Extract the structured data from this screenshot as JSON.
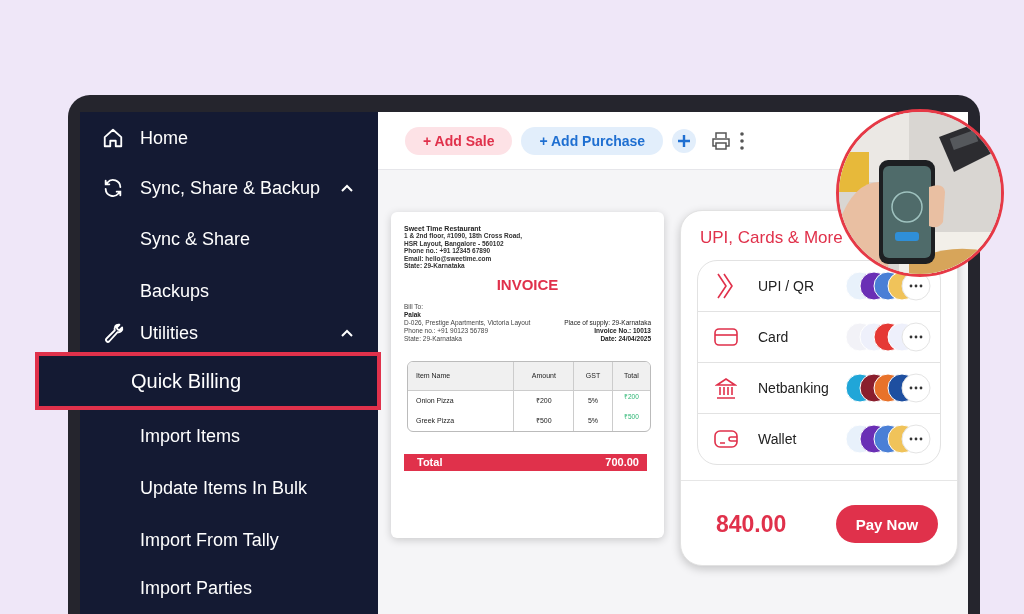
{
  "sidebar": {
    "items": [
      {
        "label": "Home",
        "kind": "home",
        "selected": false
      },
      {
        "label": "Sync, Share & Backup",
        "kind": "sync",
        "selected": false,
        "expanded": true,
        "children": [
          {
            "label": "Sync & Share",
            "selected": false
          },
          {
            "label": "Backups",
            "selected": false
          }
        ]
      },
      {
        "label": "Utilities",
        "kind": "tools",
        "selected": false,
        "expanded": true,
        "children": [
          {
            "label": "Quick Billing",
            "selected": true
          },
          {
            "label": "Import Items",
            "selected": false
          },
          {
            "label": "Update Items In Bulk",
            "selected": false
          },
          {
            "label": "Import From Tally",
            "selected": false
          },
          {
            "label": "Import Parties",
            "selected": false
          }
        ]
      }
    ]
  },
  "toolbar": {
    "buttons": [
      {
        "label": "+ Add Sale",
        "kind": "sale"
      },
      {
        "label": "+ Add Purchase",
        "kind": "purchase"
      }
    ]
  },
  "invoice": {
    "business": "Sweet Time Restaurant",
    "address_lines": [
      "1 & 2nd floor, #1090, 18th Cross Road,",
      "HSR Layout, Bangalore - 560102",
      "Phone no.: +91 12345 67890",
      "Email: hello@sweetime.com",
      "State: 29-Karnataka"
    ],
    "title": "INVOICE",
    "bill_to_label": "Bill To:",
    "customer": "Palak",
    "customer_lines": [
      "D-026, Prestige Apartments, Victoria Layout",
      "Phone no.: +91 90123 56789",
      "State: 29-Karnataka"
    ],
    "place_of_supply": "Place of supply: 29-Karnataka",
    "invoice_no": "Invoice No.: 10013",
    "date": "Date: 24/04/2025",
    "table": {
      "columns": [
        "Item Name",
        "Amount",
        "GST",
        "Total"
      ],
      "rows": [
        [
          "Onion Pizza",
          "₹200",
          "5%",
          "₹200"
        ],
        [
          "Greek Pizza",
          "₹500",
          "5%",
          "₹500"
        ]
      ]
    },
    "total_label": "Total",
    "total": "700.00"
  },
  "payment": {
    "title": "UPI, Cards & More",
    "methods": [
      {
        "label": "UPI / QR",
        "kind": "upi"
      },
      {
        "label": "Card",
        "kind": "card"
      },
      {
        "label": "Netbanking",
        "kind": "bank"
      },
      {
        "label": "Wallet",
        "kind": "wallet"
      }
    ],
    "amount": "840.00",
    "button": "Pay Now"
  }
}
